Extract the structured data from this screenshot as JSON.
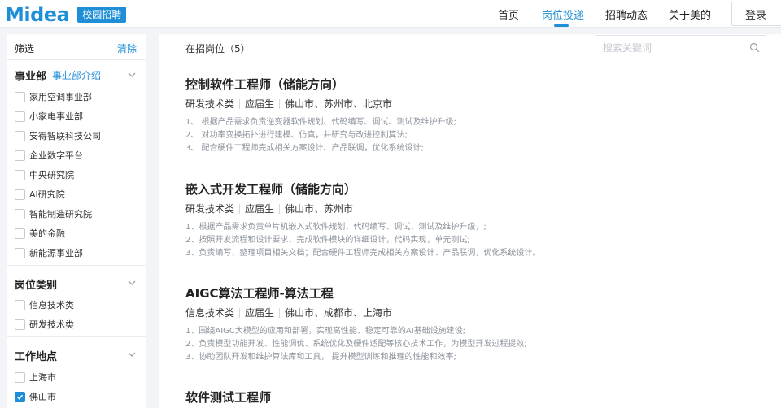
{
  "header": {
    "logo_text": "Midea",
    "logo_tag": "校园招聘",
    "nav": [
      {
        "label": "首页",
        "active": false
      },
      {
        "label": "岗位投递",
        "active": true
      },
      {
        "label": "招聘动态",
        "active": false
      },
      {
        "label": "关于美的",
        "active": false
      }
    ],
    "login_label": "登录",
    "accent_color": "#1e8fd6"
  },
  "sidebar": {
    "filter_label": "筛选",
    "clear_label": "清除",
    "sections": [
      {
        "title": "事业部",
        "link": "事业部介绍",
        "options": [
          {
            "label": "家用空调事业部",
            "checked": false
          },
          {
            "label": "小家电事业部",
            "checked": false
          },
          {
            "label": "安得智联科技公司",
            "checked": false
          },
          {
            "label": "企业数字平台",
            "checked": false
          },
          {
            "label": "中央研究院",
            "checked": false
          },
          {
            "label": "AI研究院",
            "checked": false
          },
          {
            "label": "智能制造研究院",
            "checked": false
          },
          {
            "label": "美的金融",
            "checked": false
          },
          {
            "label": "新能源事业部",
            "checked": false
          }
        ]
      },
      {
        "title": "岗位类别",
        "link": "",
        "options": [
          {
            "label": "信息技术类",
            "checked": false
          },
          {
            "label": "研发技术类",
            "checked": false
          }
        ]
      },
      {
        "title": "工作地点",
        "link": "",
        "options": [
          {
            "label": "上海市",
            "checked": false
          },
          {
            "label": "佛山市",
            "checked": true
          }
        ]
      }
    ]
  },
  "main": {
    "count_label": "在招岗位（5）",
    "search_placeholder": "搜索关键词",
    "jobs": [
      {
        "title": "控制软件工程师（储能方向）",
        "category": "研发技术类",
        "type": "应届生",
        "locations": "佛山市、苏州市、北京市",
        "desc": [
          "1、 根据产品需求负责逆变器软件规划、代码编写、调试、测试及维护升级;",
          "2、 对功率变换拓扑进行建模、仿真，并研究与改进控制算法;",
          "3、 配合硬件工程师完成相关方案设计、产品联调，优化系统设计;"
        ]
      },
      {
        "title": "嵌入式开发工程师（储能方向）",
        "category": "研发技术类",
        "type": "应届生",
        "locations": "佛山市、苏州市",
        "desc": [
          "1、根据产品需求负责单片机嵌入式软件规划、代码编写、调试、测试及维护升级，;",
          "2、按照开发流程和设计要求，完成软件模块的详细设计，代码实现，单元测试;",
          "3、负责编写、整理项目相关文档；配合硬件工程师完成相关方案设计、产品联调，优化系统设计。"
        ]
      },
      {
        "title": "AIGC算法工程师-算法工程",
        "category": "信息技术类",
        "type": "应届生",
        "locations": "佛山市、成都市、上海市",
        "desc": [
          "1、围绕AIGC大模型的应用和部署，实现高性能、稳定可靠的AI基础设施建设;",
          "2、负责模型功能开发、性能调优、系统优化及硬件适配等核心技术工作，为模型开发过程提效;",
          "3、协助团队开发和维护算法库和工具， 提升模型训练和推理的性能和效率;"
        ]
      },
      {
        "title": "软件测试工程师",
        "category": "",
        "type": "",
        "locations": "",
        "desc": []
      }
    ]
  }
}
